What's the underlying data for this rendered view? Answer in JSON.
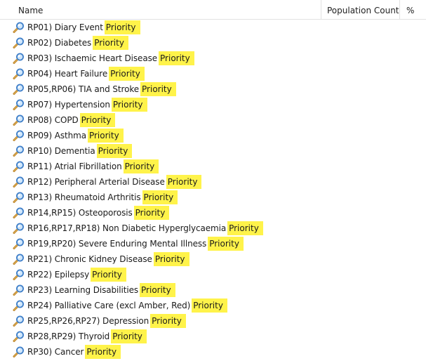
{
  "columns": {
    "name": "Name",
    "population_count": "Population Count",
    "percent": "%"
  },
  "icon": "magnifier-icon",
  "highlight_color": "#fff34a",
  "rows": [
    {
      "label": "RP01) Diary Event",
      "tag": "Priority"
    },
    {
      "label": "RP02) Diabetes",
      "tag": "Priority"
    },
    {
      "label": "RP03) Ischaemic Heart Disease",
      "tag": "Priority"
    },
    {
      "label": "RP04) Heart Failure",
      "tag": "Priority"
    },
    {
      "label": "RP05,RP06) TIA and Stroke",
      "tag": "Priority"
    },
    {
      "label": "RP07) Hypertension",
      "tag": "Priority"
    },
    {
      "label": "RP08) COPD",
      "tag": "Priority"
    },
    {
      "label": "RP09) Asthma",
      "tag": "Priority"
    },
    {
      "label": "RP10) Dementia",
      "tag": "Priority"
    },
    {
      "label": "RP11) Atrial Fibrillation",
      "tag": "Priority"
    },
    {
      "label": "RP12) Peripheral Arterial Disease",
      "tag": "Priority"
    },
    {
      "label": "RP13) Rheumatoid Arthritis",
      "tag": "Priority"
    },
    {
      "label": "RP14,RP15) Osteoporosis",
      "tag": "Priority"
    },
    {
      "label": "RP16,RP17,RP18) Non Diabetic Hyperglycaemia",
      "tag": "Priority"
    },
    {
      "label": "RP19,RP20) Severe Enduring Mental Illness",
      "tag": "Priority"
    },
    {
      "label": "RP21) Chronic Kidney Disease",
      "tag": "Priority"
    },
    {
      "label": "RP22) Epilepsy",
      "tag": "Priority"
    },
    {
      "label": "RP23) Learning Disabilities",
      "tag": "Priority"
    },
    {
      "label": "RP24) Palliative Care (excl Amber, Red)",
      "tag": "Priority"
    },
    {
      "label": "RP25,RP26,RP27) Depression",
      "tag": "Priority"
    },
    {
      "label": "RP28,RP29) Thyroid",
      "tag": "Priority"
    },
    {
      "label": "RP30) Cancer",
      "tag": "Priority"
    }
  ]
}
